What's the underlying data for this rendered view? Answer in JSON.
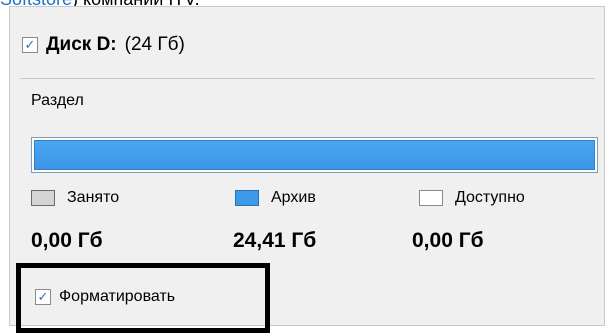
{
  "caption": {
    "link_text": "Softstore",
    "rest_text": ") компании ITV."
  },
  "disk": {
    "checked": true,
    "title": "Диск D:",
    "size": "(24 Гб)"
  },
  "partition": {
    "label": "Раздел",
    "bar_fill_fraction": 1.0,
    "colors": {
      "archive": "#3d9ae8",
      "used": "#d4d4d4",
      "free": "#ffffff"
    }
  },
  "legend": {
    "used": "Занято",
    "archive": "Архив",
    "free": "Доступно"
  },
  "values": {
    "used": "0,00 Гб",
    "archive": "24,41 Гб",
    "free": "0,00 Гб"
  },
  "format": {
    "checked": true,
    "label": "Форматировать"
  }
}
